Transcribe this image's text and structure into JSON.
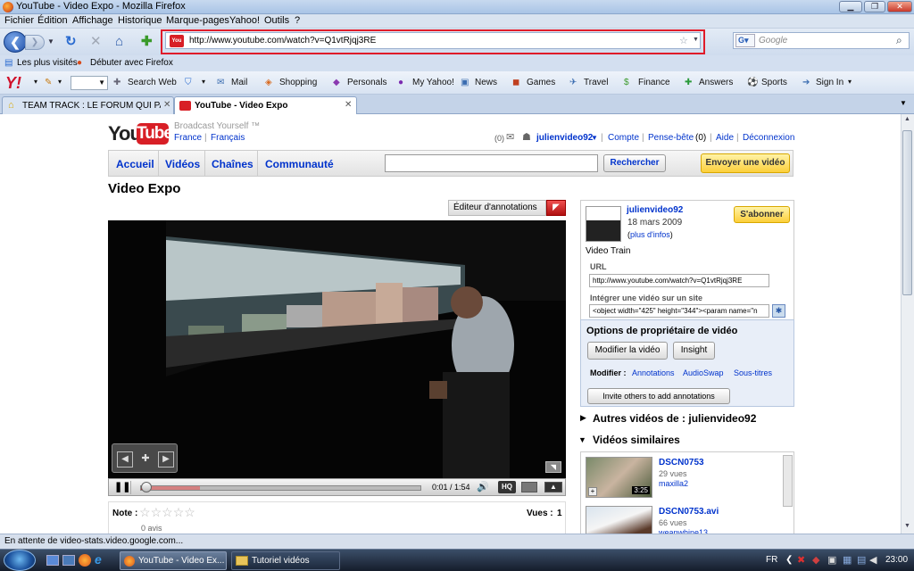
{
  "window": {
    "title": "YouTube - Video Expo - Mozilla Firefox"
  },
  "menu": [
    "Fichier",
    "Édition",
    "Affichage",
    "Historique",
    "Marque-pages",
    "Yahoo!",
    "Outils",
    "?"
  ],
  "address": {
    "url": "http://www.youtube.com/watch?v=Q1vtRjqj3RE"
  },
  "search": {
    "placeholder": "Google"
  },
  "bookmarks": [
    "Les plus visités",
    "Débuter avec Firefox"
  ],
  "yahoo_toolbar": {
    "search_label": "Search Web",
    "items": [
      "Mail",
      "Shopping",
      "Personals",
      "My Yahoo!",
      "News",
      "Games",
      "Travel",
      "Finance",
      "Answers",
      "Sports",
      "Sign In"
    ]
  },
  "tabs": [
    {
      "label": "TEAM TRACK : LE FORUM QUI PAR..."
    },
    {
      "label": "YouTube - Video Expo"
    }
  ],
  "yt": {
    "tagline": "Broadcast Yourself ™",
    "region": "France",
    "language": "Français",
    "msg_count": "(0)",
    "username": "julienvideo92",
    "account": "Compte",
    "quicklist": "Pense-bête",
    "quicklist_count": "(0)",
    "help": "Aide",
    "logout": "Déconnexion",
    "nav": [
      "Accueil",
      "Vidéos",
      "Chaînes",
      "Communauté"
    ],
    "search_button": "Rechercher",
    "upload_button": "Envoyer une vidéo",
    "video_title": "Video Expo",
    "annotation_editor": "Éditeur d'annotations",
    "player": {
      "time": "0:01 / 1:54",
      "hq": "HQ",
      "progress": 0.02,
      "buffered": 0.21
    },
    "rating_label": "Note :",
    "rating_count": "0 avis",
    "views_label": "Vues :",
    "views": "1"
  },
  "sidebar": {
    "channel": "julienvideo92",
    "date": "18 mars 2009",
    "more_info": "plus d'infos",
    "subscribe": "S'abonner",
    "description": "Video Train",
    "url_label": "URL",
    "url_value": "http://www.youtube.com/watch?v=Q1vtRjqj3RE",
    "embed_label": "Intégrer une vidéo sur un site",
    "embed_value": "<object width=\"425\" height=\"344\"><param name=\"n",
    "owner_title": "Options de propriétaire de vidéo",
    "edit_video": "Modifier la vidéo",
    "insight": "Insight",
    "modify_label": "Modifier :",
    "modify_links": [
      "Annotations",
      "AudioSwap",
      "Sous-titres"
    ],
    "invite": "Invite others to add annotations",
    "more_from": "Autres vidéos de : julienvideo92",
    "related_title": "Vidéos similaires",
    "related": [
      {
        "title": "DSCN0753",
        "views": "29 vues",
        "user": "maxilla2",
        "duration": "3:25"
      },
      {
        "title": "DSCN0753.avi",
        "views": "66 vues",
        "user": "weanwhine13",
        "duration": ""
      }
    ]
  },
  "status": {
    "text": "En attente de video-stats.video.google.com..."
  },
  "taskbar": {
    "items": [
      "YouTube - Video Ex...",
      "Tutoriel vidéos"
    ],
    "lang": "FR",
    "clock": "23:00"
  },
  "colors": {
    "accent_red": "#e01b2a",
    "youtube_red": "#d81f26",
    "link_blue": "#0033cc"
  }
}
